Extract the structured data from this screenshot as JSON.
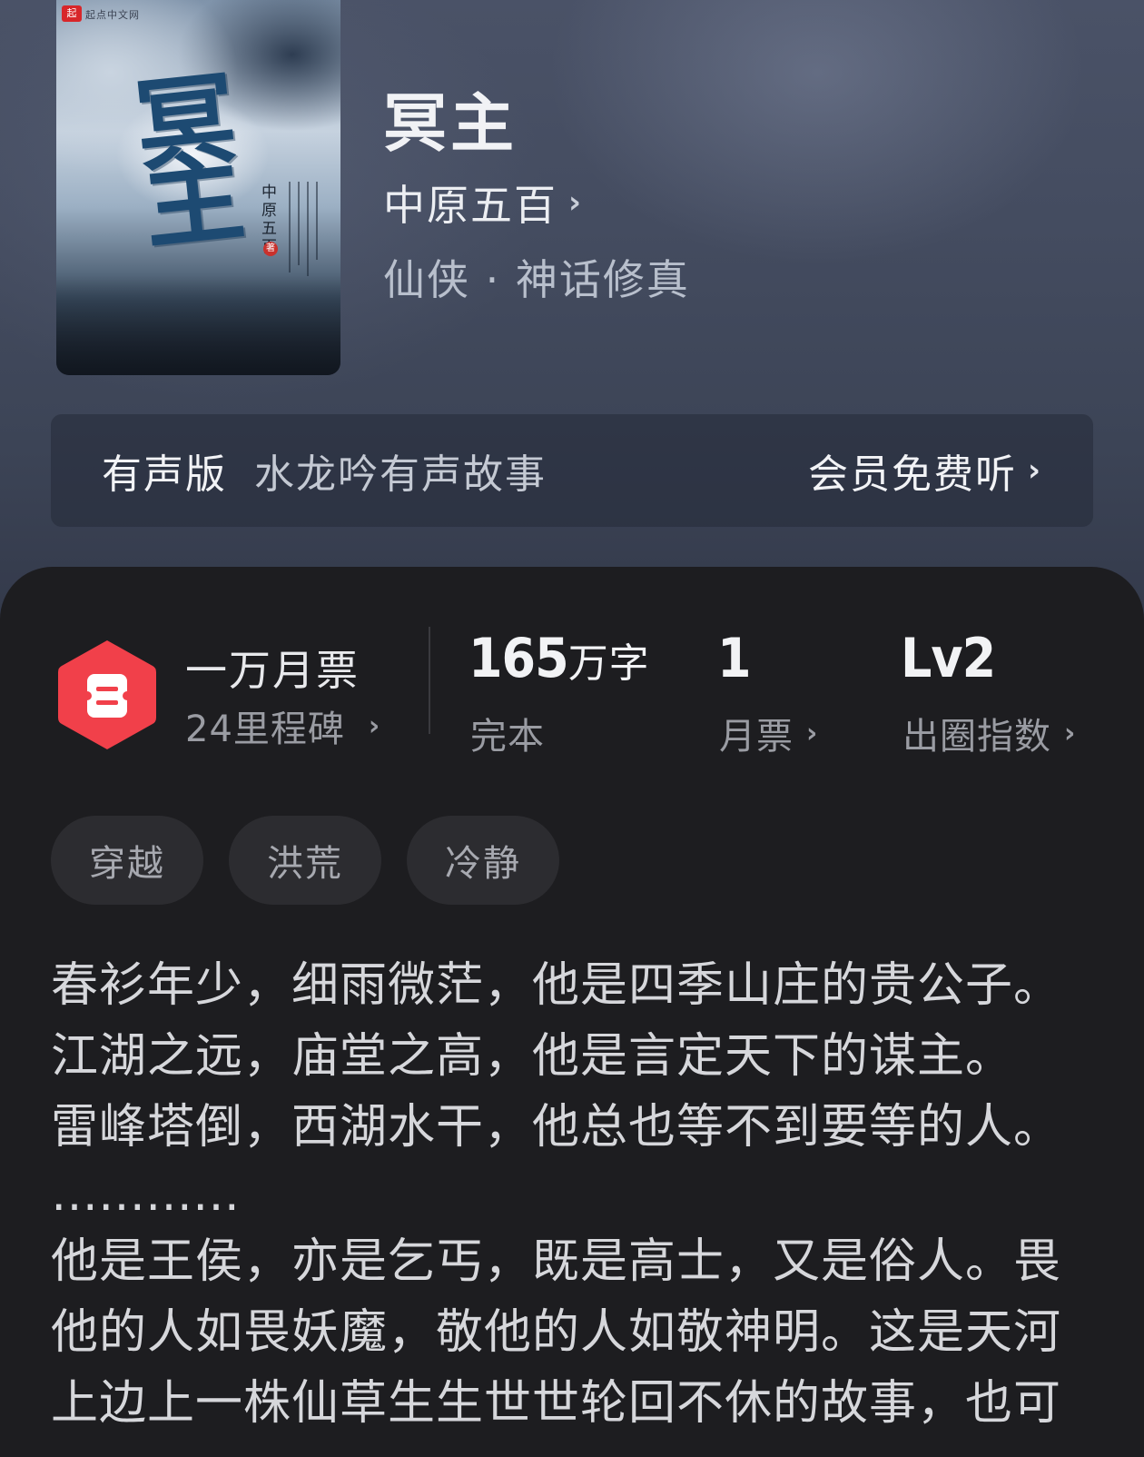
{
  "cover": {
    "publisher_mark": "起",
    "publisher_text": "起点中文网",
    "title_art": "冥主",
    "author_vertical": "中原五百",
    "seal": "著"
  },
  "book": {
    "title": "冥主",
    "author": "中原五百",
    "genre": "仙侠 · 神话修真"
  },
  "audio": {
    "label": "有声版",
    "narrator": "水龙吟有声故事",
    "cta": "会员免费听"
  },
  "stats": {
    "monthly_ticket_rank": "一万月票",
    "milestone": "24里程碑",
    "word_count": "165",
    "word_unit": "万字",
    "word_status": "完本",
    "ticket_count": "1",
    "ticket_label": "月票",
    "level": "Lv2",
    "level_label": "出圈指数"
  },
  "tags": [
    "穿越",
    "洪荒",
    "冷静"
  ],
  "synopsis": {
    "lines": [
      "春衫年少，细雨微茫，他是四季山庄的贵公子。",
      "江湖之远，庙堂之高，他是言定天下的谋主。",
      "雷峰塔倒，西湖水干，他总也等不到要等的人。",
      "…………",
      "他是王侯，亦是乞丐，既是高士，又是俗人。畏",
      "他的人如畏妖魔，敬他的人如敬神明。这是天河",
      "上边上一株仙草生生世世轮回不休的故事，也可"
    ]
  },
  "colors": {
    "badge": "#f1404a",
    "panel": "#1d1d20"
  }
}
